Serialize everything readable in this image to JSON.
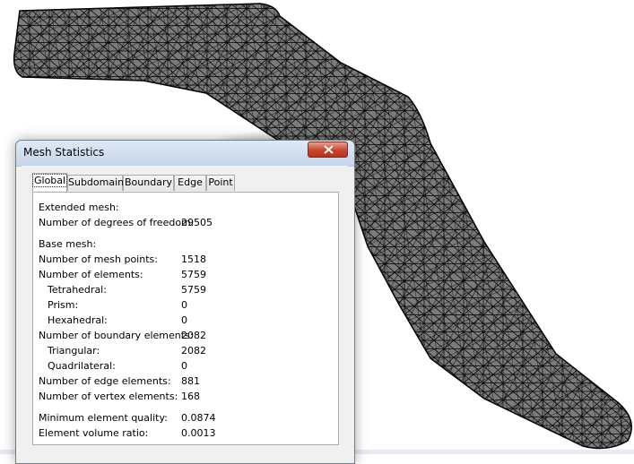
{
  "dialog": {
    "title": "Mesh Statistics"
  },
  "tabs": [
    {
      "label": "Global"
    },
    {
      "label": "Subdomain"
    },
    {
      "label": "Boundary"
    },
    {
      "label": "Edge"
    },
    {
      "label": "Point"
    }
  ],
  "stats": {
    "extended_heading": "Extended mesh:",
    "dof_label": "Number of degrees of freedom:",
    "dof_value": "29505",
    "base_heading": "Base mesh:",
    "mesh_points_label": "Number of mesh points:",
    "mesh_points_value": "1518",
    "elements_label": "Number of elements:",
    "elements_value": "5759",
    "tetrahedral_label": "Tetrahedral:",
    "tetrahedral_value": "5759",
    "prism_label": "Prism:",
    "prism_value": "0",
    "hexahedral_label": "Hexahedral:",
    "hexahedral_value": "0",
    "boundary_label": "Number of boundary elements:",
    "boundary_value": "2082",
    "triangular_label": "Triangular:",
    "triangular_value": "2082",
    "quadrilateral_label": "Quadrilateral:",
    "quadrilateral_value": "0",
    "edge_label": "Number of edge elements:",
    "edge_value": "881",
    "vertex_label": "Number of vertex elements:",
    "vertex_value": "168",
    "min_quality_label": "Minimum element quality:",
    "min_quality_value": "0.0874",
    "volume_ratio_label": "Element volume ratio:",
    "volume_ratio_value": "0.0013"
  },
  "colors": {
    "mesh_fill": "#7b7b7b",
    "mesh_lines": "#000000",
    "title_bar": "#cfdcec",
    "close_button": "#c9452f"
  },
  "icons": {
    "close": "close-icon"
  }
}
